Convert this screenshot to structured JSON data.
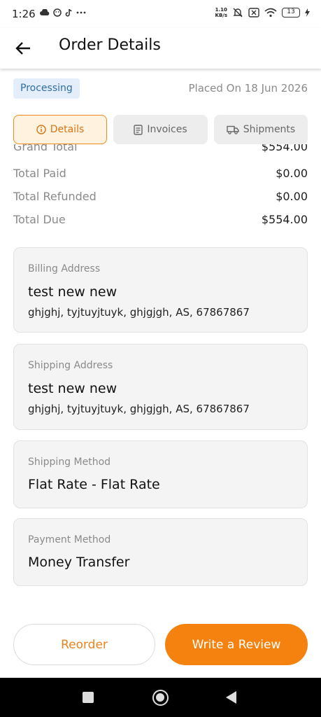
{
  "status_bar": {
    "time": "1:26",
    "net_speed_value": "1.10",
    "net_speed_unit": "KB/s",
    "battery": "13"
  },
  "app_bar": {
    "title": "Order Details",
    "back_icon": "arrow-left-icon"
  },
  "order": {
    "status": "Processing",
    "placed_on": "Placed On 18 Jun 2026"
  },
  "tabs": [
    {
      "label": "Details",
      "icon": "info-icon",
      "active": true
    },
    {
      "label": "Invoices",
      "icon": "invoice-icon",
      "active": false
    },
    {
      "label": "Shipments",
      "icon": "truck-icon",
      "active": false
    }
  ],
  "totals": [
    {
      "label": "Grand Total",
      "value": "$554.00"
    },
    {
      "label": "Total Paid",
      "value": "$0.00"
    },
    {
      "label": "Total Refunded",
      "value": "$0.00"
    },
    {
      "label": "Total Due",
      "value": "$554.00"
    }
  ],
  "billing": {
    "label": "Billing Address",
    "name": "test new new",
    "address": "ghjghj, tyjtuyjtuyk, ghjgjgh, AS, 67867867"
  },
  "shipping": {
    "label": "Shipping Address",
    "name": "test new new",
    "address": "ghjghj, tyjtuyjtuyk, ghjgjgh, AS, 67867867"
  },
  "shipping_method": {
    "label": "Shipping Method",
    "value": "Flat Rate - Flat Rate"
  },
  "payment_method": {
    "label": "Payment Method",
    "value": "Money Transfer"
  },
  "actions": {
    "reorder": "Reorder",
    "review": "Write a Review"
  },
  "colors": {
    "accent": "#f5820f",
    "status_chip_bg": "#e3eefa",
    "status_chip_text": "#2f6ea5"
  }
}
